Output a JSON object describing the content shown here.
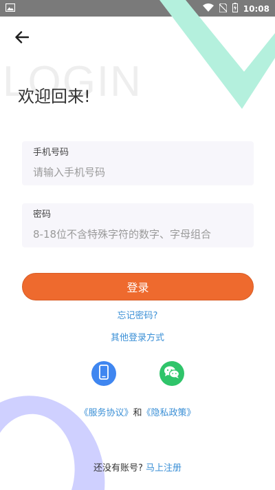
{
  "status_bar": {
    "time": "10:08",
    "icons": [
      "gallery-icon",
      "wifi-icon",
      "no-sim-icon",
      "battery-charging-icon"
    ]
  },
  "header": {
    "back_icon": "arrow-left-icon",
    "watermark": "LOGIN",
    "welcome": "欢迎回来!"
  },
  "form": {
    "phone": {
      "label": "手机号码",
      "placeholder": "请输入手机号码",
      "value": ""
    },
    "password": {
      "label": "密码",
      "placeholder": "8-18位不含特殊字符的数字、字母组合",
      "value": ""
    },
    "login_label": "登录",
    "forgot_label": "忘记密码?",
    "other_methods_label": "其他登录方式"
  },
  "social": {
    "phone_icon": "mobile-phone-icon",
    "wechat_icon": "wechat-icon"
  },
  "agreement": {
    "service": "《服务协议》",
    "and": "和",
    "privacy": "《隐私政策》"
  },
  "signup": {
    "prompt": "还没有账号?",
    "link": "马上注册"
  },
  "colors": {
    "accent": "#ee6a2e",
    "link": "#3a8fd6",
    "field_bg": "#f7f6fb",
    "deco_mint": "#b4f0dd",
    "deco_lavender": "#cfd0ff",
    "phone_icon_bg": "#3f86f0",
    "wechat_icon_bg": "#2fc46a"
  }
}
